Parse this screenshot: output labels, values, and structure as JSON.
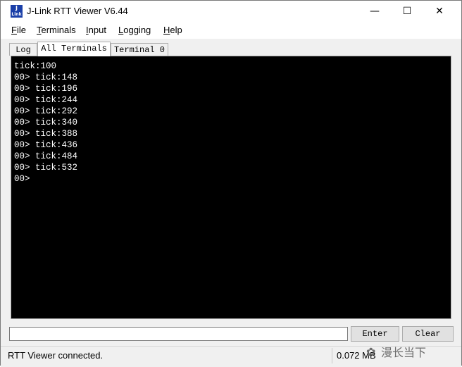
{
  "window": {
    "title": "J-Link RTT Viewer V6.44",
    "icon_text_top": "J",
    "icon_text_bottom": "Link",
    "controls": {
      "minimize": "—",
      "maximize": "☐",
      "close": "✕"
    }
  },
  "menu": [
    {
      "accel": "F",
      "rest": "ile"
    },
    {
      "accel": "T",
      "rest": "erminals"
    },
    {
      "accel": "I",
      "rest": "nput"
    },
    {
      "accel": "L",
      "rest": "ogging"
    },
    {
      "accel": "H",
      "rest": "elp"
    }
  ],
  "tabs": [
    "Log",
    "All Terminals",
    "Terminal 0"
  ],
  "active_tab": "All Terminals",
  "terminal": {
    "lines": [
      "tick:100",
      "00> tick:148",
      "00> tick:196",
      "00> tick:244",
      "00> tick:292",
      "00> tick:340",
      "00> tick:388",
      "00> tick:436",
      "00> tick:484",
      "00> tick:532",
      "00>"
    ]
  },
  "input": {
    "value": ""
  },
  "buttons": {
    "enter": "Enter",
    "clear": "Clear"
  },
  "status": {
    "message": "RTT Viewer connected.",
    "data_size": "0.072 MB"
  },
  "watermark": {
    "icon": "wechat-icon",
    "text": "漫长当下"
  },
  "colors": {
    "terminal_bg": "#000000",
    "terminal_fg": "#ffffff",
    "icon_bg": "#1a3fa8"
  }
}
